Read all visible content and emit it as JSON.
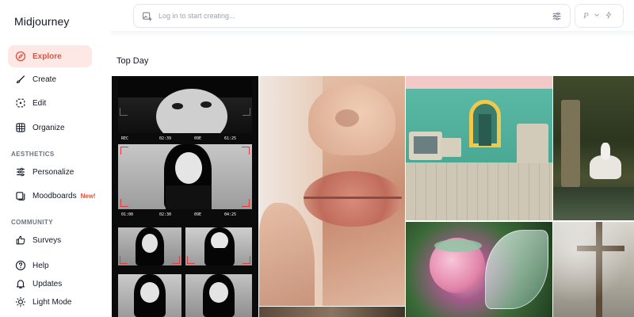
{
  "app": {
    "brand": "Midjourney"
  },
  "sidebar": {
    "items": [
      {
        "label": "Explore",
        "icon": "compass-icon",
        "active": true
      },
      {
        "label": "Create",
        "icon": "brush-icon"
      },
      {
        "label": "Edit",
        "icon": "edit-icon"
      },
      {
        "label": "Organize",
        "icon": "grid-icon"
      }
    ],
    "aesthetics_label": "AESTHETICS",
    "aesthetics_items": [
      {
        "label": "Personalize",
        "icon": "sliders-icon"
      },
      {
        "label": "Moodboards",
        "icon": "moodboard-icon",
        "badge": "New!"
      }
    ],
    "community_label": "COMMUNITY",
    "community_items": [
      {
        "label": "Surveys",
        "icon": "thumbs-up-icon"
      }
    ],
    "bottom_items": [
      {
        "label": "Help",
        "icon": "help-icon"
      },
      {
        "label": "Updates",
        "icon": "bell-icon"
      },
      {
        "label": "Light Mode",
        "icon": "sun-icon"
      }
    ]
  },
  "search": {
    "placeholder": "Log in to start creating..."
  },
  "mode": {
    "label": "P"
  },
  "main": {
    "section_title": "Top Day"
  },
  "gallery": {
    "strip_labels": {
      "rec": "REC",
      "time1": "02:39",
      "iso1": "09E",
      "batt1": "61:25",
      "time2": "01:00",
      "time2b": "02:30",
      "iso2": "09E",
      "batt2": "04:25"
    }
  },
  "colors": {
    "accent": "#e0533d",
    "active_bg": "#fde8e6"
  }
}
